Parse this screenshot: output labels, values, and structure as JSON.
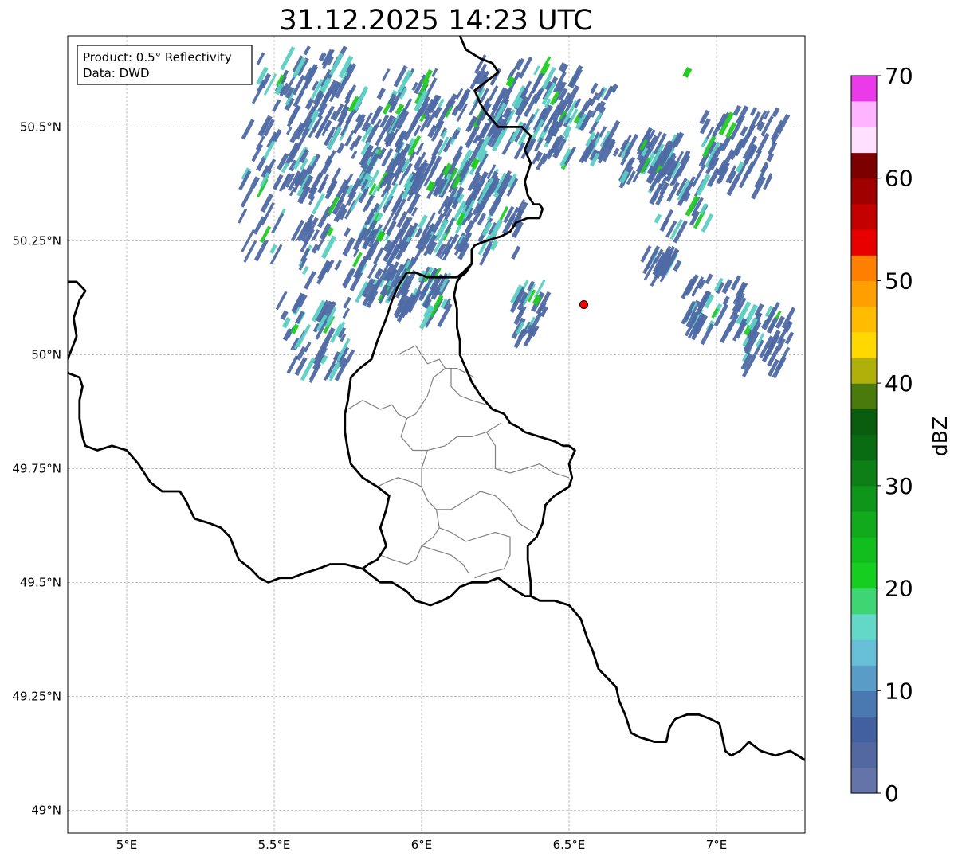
{
  "title": "31.12.2025 14:23 UTC",
  "info_box": {
    "product_line": "Product: 0.5° Reflectivity",
    "data_line": "Data: DWD"
  },
  "map_extent": {
    "lon_min": 4.8,
    "lon_max": 7.3,
    "lat_min": 48.95,
    "lat_max": 50.7
  },
  "lon_ticks": [
    {
      "value": 5.0,
      "label": "5°E"
    },
    {
      "value": 5.5,
      "label": "5.5°E"
    },
    {
      "value": 6.0,
      "label": "6°E"
    },
    {
      "value": 6.5,
      "label": "6.5°E"
    },
    {
      "value": 7.0,
      "label": "7°E"
    }
  ],
  "lat_ticks": [
    {
      "value": 50.5,
      "label": "50.5°N"
    },
    {
      "value": 50.25,
      "label": "50.25°N"
    },
    {
      "value": 50.0,
      "label": "50°N"
    },
    {
      "value": 49.75,
      "label": "49.75°N"
    },
    {
      "value": 49.5,
      "label": "49.5°N"
    },
    {
      "value": 49.25,
      "label": "49.25°N"
    },
    {
      "value": 49.0,
      "label": "49°N"
    }
  ],
  "gridlines": true,
  "radar_site": {
    "lon": 6.55,
    "lat": 50.11,
    "color": "#ff0000"
  },
  "colorbar": {
    "label": "dBZ",
    "min": 0,
    "max": 70,
    "step": 2.5,
    "tick_labels": [
      "0",
      "10",
      "20",
      "30",
      "40",
      "50",
      "60",
      "70"
    ],
    "colors": [
      "#6473a8",
      "#5367a0",
      "#4260a0",
      "#4a78b0",
      "#5a9cc8",
      "#68c0d8",
      "#64d8c8",
      "#3ed674",
      "#16ce20",
      "#12be1e",
      "#10aa1c",
      "#0e961a",
      "#0c8016",
      "#0a6c12",
      "#0a5c0e",
      "#4a7a0c",
      "#b0b00a",
      "#ffd800",
      "#ffbc00",
      "#ffa000",
      "#ff8000",
      "#e80000",
      "#c40000",
      "#a00000",
      "#7c0000",
      "#ffe0ff",
      "#ffb4ff",
      "#ff78ff",
      "#ea3aea"
    ]
  },
  "colors": {
    "border": "#000000",
    "admin_border": "#808080",
    "grid": "#b0b0b0",
    "echo_weak": "#4f6aa4",
    "echo_mid": "#5ccfc4",
    "echo_strong": "#22cc22"
  },
  "echo_clusters": [
    {
      "lon": 5.62,
      "lat": 50.58,
      "dlon": 0.16,
      "dlat": 0.1
    },
    {
      "lon": 5.85,
      "lat": 50.52,
      "dlon": 0.22,
      "dlat": 0.12
    },
    {
      "lon": 6.05,
      "lat": 50.47,
      "dlon": 0.25,
      "dlat": 0.12
    },
    {
      "lon": 6.35,
      "lat": 50.56,
      "dlon": 0.2,
      "dlat": 0.1
    },
    {
      "lon": 6.52,
      "lat": 50.52,
      "dlon": 0.15,
      "dlat": 0.08
    },
    {
      "lon": 5.52,
      "lat": 50.38,
      "dlon": 0.12,
      "dlat": 0.14
    },
    {
      "lon": 5.75,
      "lat": 50.3,
      "dlon": 0.16,
      "dlat": 0.14
    },
    {
      "lon": 6.0,
      "lat": 50.36,
      "dlon": 0.18,
      "dlat": 0.1
    },
    {
      "lon": 6.2,
      "lat": 50.33,
      "dlon": 0.15,
      "dlat": 0.1
    },
    {
      "lon": 5.9,
      "lat": 50.22,
      "dlon": 0.14,
      "dlat": 0.08
    },
    {
      "lon": 5.65,
      "lat": 50.06,
      "dlon": 0.12,
      "dlat": 0.08
    },
    {
      "lon": 6.88,
      "lat": 50.37,
      "dlon": 0.1,
      "dlat": 0.08
    },
    {
      "lon": 7.1,
      "lat": 50.47,
      "dlon": 0.14,
      "dlat": 0.08
    },
    {
      "lon": 6.78,
      "lat": 50.45,
      "dlon": 0.1,
      "dlat": 0.05
    },
    {
      "lon": 7.18,
      "lat": 50.05,
      "dlon": 0.08,
      "dlat": 0.07
    },
    {
      "lon": 7.0,
      "lat": 50.12,
      "dlon": 0.1,
      "dlat": 0.06
    },
    {
      "lon": 6.38,
      "lat": 50.11,
      "dlon": 0.05,
      "dlat": 0.06
    },
    {
      "lon": 6.0,
      "lat": 50.15,
      "dlon": 0.1,
      "dlat": 0.05
    },
    {
      "lon": 6.82,
      "lat": 50.22,
      "dlon": 0.05,
      "dlat": 0.02
    }
  ],
  "echo_hotspots": [
    {
      "lon": 6.03,
      "lat": 50.37
    },
    {
      "lon": 6.3,
      "lat": 50.6
    },
    {
      "lon": 6.18,
      "lat": 50.42
    },
    {
      "lon": 6.9,
      "lat": 50.62
    },
    {
      "lon": 6.39,
      "lat": 50.12
    },
    {
      "lon": 5.86,
      "lat": 50.26
    }
  ],
  "borders": [
    [
      [
        6.13,
        50.7
      ],
      [
        6.15,
        50.67
      ],
      [
        6.2,
        50.65
      ],
      [
        6.24,
        50.64
      ],
      [
        6.26,
        50.62
      ],
      [
        6.22,
        50.6
      ],
      [
        6.18,
        50.58
      ],
      [
        6.2,
        50.55
      ],
      [
        6.22,
        50.53
      ],
      [
        6.26,
        50.5
      ],
      [
        6.32,
        50.5
      ],
      [
        6.34,
        50.5
      ],
      [
        6.37,
        50.48
      ],
      [
        6.35,
        50.45
      ],
      [
        6.37,
        50.42
      ],
      [
        6.35,
        50.38
      ],
      [
        6.36,
        50.35
      ],
      [
        6.38,
        50.33
      ],
      [
        6.4,
        50.33
      ],
      [
        6.41,
        50.32
      ],
      [
        6.4,
        50.3
      ],
      [
        6.36,
        50.3
      ],
      [
        6.32,
        50.29
      ],
      [
        6.3,
        50.27
      ],
      [
        6.27,
        50.26
      ],
      [
        6.22,
        50.25
      ],
      [
        6.18,
        50.24
      ],
      [
        6.17,
        50.23
      ],
      [
        6.17,
        50.2
      ],
      [
        6.15,
        50.18
      ],
      [
        6.13,
        50.17
      ],
      [
        6.12,
        50.16
      ],
      [
        6.11,
        50.13
      ],
      [
        6.12,
        50.1
      ],
      [
        6.12,
        50.06
      ],
      [
        6.13,
        50.03
      ],
      [
        6.13,
        50.0
      ],
      [
        6.15,
        49.97
      ],
      [
        6.17,
        49.94
      ],
      [
        6.2,
        49.91
      ],
      [
        6.24,
        49.88
      ],
      [
        6.28,
        49.87
      ],
      [
        6.3,
        49.85
      ],
      [
        6.33,
        49.84
      ],
      [
        6.35,
        49.83
      ],
      [
        6.4,
        49.82
      ],
      [
        6.45,
        49.81
      ],
      [
        6.48,
        49.8
      ],
      [
        6.5,
        49.8
      ],
      [
        6.52,
        49.79
      ],
      [
        6.5,
        49.76
      ],
      [
        6.51,
        49.73
      ],
      [
        6.5,
        49.71
      ],
      [
        6.45,
        49.69
      ],
      [
        6.42,
        49.67
      ],
      [
        6.41,
        49.63
      ],
      [
        6.39,
        49.6
      ],
      [
        6.36,
        49.58
      ],
      [
        6.36,
        49.55
      ],
      [
        6.37,
        49.5
      ],
      [
        6.37,
        49.47
      ]
    ],
    [
      [
        6.17,
        50.2
      ],
      [
        6.14,
        50.18
      ],
      [
        6.12,
        50.17
      ],
      [
        6.09,
        50.17
      ],
      [
        6.05,
        50.17
      ],
      [
        6.02,
        50.17
      ],
      [
        5.98,
        50.18
      ],
      [
        5.95,
        50.18
      ],
      [
        5.92,
        50.15
      ],
      [
        5.9,
        50.12
      ],
      [
        5.88,
        50.08
      ],
      [
        5.85,
        50.03
      ],
      [
        5.83,
        49.99
      ],
      [
        5.79,
        49.97
      ],
      [
        5.76,
        49.95
      ],
      [
        5.75,
        49.9
      ],
      [
        5.74,
        49.87
      ],
      [
        5.74,
        49.83
      ],
      [
        5.75,
        49.79
      ],
      [
        5.76,
        49.76
      ],
      [
        5.8,
        49.73
      ],
      [
        5.85,
        49.71
      ],
      [
        5.89,
        49.69
      ],
      [
        5.88,
        49.66
      ],
      [
        5.86,
        49.62
      ],
      [
        5.88,
        49.58
      ],
      [
        5.85,
        49.55
      ],
      [
        5.82,
        49.54
      ],
      [
        5.8,
        49.53
      ]
    ],
    [
      [
        5.8,
        49.53
      ],
      [
        5.74,
        49.54
      ],
      [
        5.69,
        49.54
      ],
      [
        5.65,
        49.53
      ],
      [
        5.6,
        49.52
      ],
      [
        5.56,
        49.51
      ],
      [
        5.52,
        49.51
      ],
      [
        5.48,
        49.5
      ],
      [
        5.45,
        49.51
      ],
      [
        5.42,
        49.53
      ],
      [
        5.38,
        49.55
      ],
      [
        5.35,
        49.6
      ],
      [
        5.32,
        49.62
      ],
      [
        5.28,
        49.63
      ],
      [
        5.23,
        49.64
      ],
      [
        5.2,
        49.68
      ],
      [
        5.18,
        49.7
      ],
      [
        5.12,
        49.7
      ],
      [
        5.08,
        49.72
      ],
      [
        5.04,
        49.76
      ],
      [
        5.0,
        49.79
      ],
      [
        4.95,
        49.8
      ],
      [
        4.9,
        49.79
      ],
      [
        4.86,
        49.8
      ],
      [
        4.85,
        49.82
      ],
      [
        4.84,
        49.86
      ],
      [
        4.84,
        49.9
      ],
      [
        4.85,
        49.93
      ],
      [
        4.84,
        49.95
      ],
      [
        4.8,
        49.96
      ]
    ],
    [
      [
        4.8,
        50.16
      ],
      [
        4.83,
        50.16
      ],
      [
        4.86,
        50.14
      ],
      [
        4.84,
        50.12
      ],
      [
        4.82,
        50.08
      ],
      [
        4.83,
        50.04
      ],
      [
        4.8,
        49.99
      ]
    ],
    [
      [
        5.8,
        49.53
      ],
      [
        5.86,
        49.5
      ],
      [
        5.9,
        49.5
      ],
      [
        5.95,
        49.48
      ],
      [
        5.98,
        49.46
      ],
      [
        6.03,
        49.45
      ],
      [
        6.07,
        49.46
      ],
      [
        6.1,
        49.47
      ],
      [
        6.13,
        49.49
      ],
      [
        6.17,
        49.5
      ],
      [
        6.22,
        49.5
      ],
      [
        6.26,
        49.51
      ],
      [
        6.3,
        49.49
      ],
      [
        6.35,
        49.47
      ],
      [
        6.37,
        49.47
      ],
      [
        6.4,
        49.46
      ],
      [
        6.45,
        49.46
      ],
      [
        6.5,
        49.45
      ],
      [
        6.54,
        49.42
      ],
      [
        6.56,
        49.38
      ],
      [
        6.58,
        49.35
      ],
      [
        6.6,
        49.31
      ],
      [
        6.63,
        49.29
      ],
      [
        6.66,
        49.27
      ],
      [
        6.67,
        49.24
      ],
      [
        6.69,
        49.21
      ],
      [
        6.71,
        49.17
      ],
      [
        6.74,
        49.16
      ],
      [
        6.79,
        49.15
      ],
      [
        6.83,
        49.15
      ],
      [
        6.84,
        49.18
      ],
      [
        6.86,
        49.2
      ],
      [
        6.9,
        49.21
      ],
      [
        6.94,
        49.21
      ],
      [
        6.98,
        49.2
      ],
      [
        7.01,
        49.19
      ],
      [
        7.02,
        49.16
      ],
      [
        7.03,
        49.13
      ],
      [
        7.05,
        49.12
      ],
      [
        7.08,
        49.13
      ],
      [
        7.11,
        49.15
      ],
      [
        7.15,
        49.13
      ],
      [
        7.2,
        49.12
      ],
      [
        7.25,
        49.13
      ],
      [
        7.3,
        49.11
      ]
    ]
  ],
  "admin_borders": [
    [
      [
        5.92,
        50.0
      ],
      [
        5.98,
        50.02
      ],
      [
        6.02,
        49.98
      ],
      [
        6.06,
        49.99
      ],
      [
        6.08,
        49.97
      ],
      [
        6.12,
        49.97
      ],
      [
        6.15,
        49.96
      ],
      [
        6.18,
        49.95
      ]
    ],
    [
      [
        6.08,
        49.97
      ],
      [
        6.04,
        49.95
      ],
      [
        6.02,
        49.91
      ],
      [
        5.98,
        49.87
      ],
      [
        5.95,
        49.86
      ],
      [
        5.93,
        49.82
      ],
      [
        5.97,
        49.79
      ],
      [
        6.02,
        49.79
      ],
      [
        6.08,
        49.8
      ],
      [
        6.12,
        49.82
      ],
      [
        6.17,
        49.82
      ],
      [
        6.22,
        49.83
      ],
      [
        6.27,
        49.85
      ]
    ],
    [
      [
        6.1,
        49.97
      ],
      [
        6.1,
        49.93
      ],
      [
        6.13,
        49.91
      ],
      [
        6.17,
        49.9
      ],
      [
        6.22,
        49.89
      ]
    ],
    [
      [
        5.75,
        49.88
      ],
      [
        5.8,
        49.9
      ],
      [
        5.86,
        49.88
      ],
      [
        5.9,
        49.89
      ],
      [
        5.92,
        49.87
      ],
      [
        5.95,
        49.86
      ]
    ],
    [
      [
        6.02,
        49.79
      ],
      [
        6.0,
        49.75
      ],
      [
        6.0,
        49.71
      ],
      [
        6.02,
        49.68
      ],
      [
        6.05,
        49.66
      ],
      [
        6.1,
        49.66
      ],
      [
        6.15,
        49.68
      ],
      [
        6.2,
        49.7
      ],
      [
        6.25,
        49.69
      ],
      [
        6.3,
        49.66
      ],
      [
        6.33,
        49.63
      ],
      [
        6.38,
        49.61
      ]
    ],
    [
      [
        6.22,
        49.83
      ],
      [
        6.25,
        49.8
      ],
      [
        6.25,
        49.75
      ],
      [
        6.3,
        49.74
      ],
      [
        6.35,
        49.75
      ],
      [
        6.4,
        49.76
      ],
      [
        6.45,
        49.74
      ],
      [
        6.5,
        49.73
      ]
    ],
    [
      [
        5.85,
        49.71
      ],
      [
        5.88,
        49.72
      ],
      [
        5.92,
        49.73
      ],
      [
        5.97,
        49.72
      ],
      [
        6.0,
        49.71
      ]
    ],
    [
      [
        6.05,
        49.66
      ],
      [
        6.06,
        49.62
      ],
      [
        6.04,
        49.6
      ],
      [
        6.0,
        49.58
      ],
      [
        5.98,
        49.55
      ],
      [
        5.95,
        49.54
      ],
      [
        5.9,
        49.55
      ],
      [
        5.86,
        49.56
      ]
    ],
    [
      [
        6.06,
        49.62
      ],
      [
        6.1,
        49.61
      ],
      [
        6.15,
        49.59
      ],
      [
        6.2,
        49.6
      ],
      [
        6.25,
        49.61
      ],
      [
        6.3,
        49.6
      ],
      [
        6.3,
        49.56
      ],
      [
        6.28,
        49.53
      ],
      [
        6.22,
        49.52
      ],
      [
        6.18,
        49.51
      ]
    ],
    [
      [
        6.0,
        49.58
      ],
      [
        6.05,
        49.57
      ],
      [
        6.1,
        49.56
      ],
      [
        6.14,
        49.54
      ],
      [
        6.16,
        49.52
      ]
    ]
  ]
}
